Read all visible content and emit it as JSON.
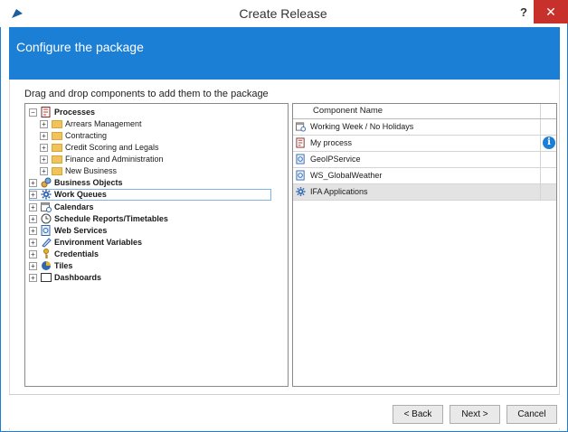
{
  "window": {
    "title": "Create Release",
    "help_label": "?",
    "close_label": "✕",
    "accent_color": "#1c7fd6",
    "close_color": "#c7302b"
  },
  "banner": {
    "title": "Configure the package"
  },
  "instruction": "Drag and drop components to add them to the package",
  "tree": {
    "items": [
      {
        "label": "Processes",
        "expander": "−",
        "icon": "process-icon",
        "bold": true
      },
      {
        "label": "Arrears Management",
        "expander": "+",
        "icon": "folder-icon",
        "bold": false
      },
      {
        "label": "Contracting",
        "expander": "+",
        "icon": "folder-icon",
        "bold": false
      },
      {
        "label": "Credit Scoring and Legals",
        "expander": "+",
        "icon": "folder-icon",
        "bold": false
      },
      {
        "label": "Finance and Administration",
        "expander": "+",
        "icon": "folder-icon",
        "bold": false
      },
      {
        "label": "New Business",
        "expander": "+",
        "icon": "folder-icon",
        "bold": false
      },
      {
        "label": "Business Objects",
        "expander": "+",
        "icon": "business-objects-icon",
        "bold": true
      },
      {
        "label": "Work Queues",
        "expander": "+",
        "icon": "gear-icon",
        "bold": true
      },
      {
        "label": "Calendars",
        "expander": "+",
        "icon": "calendar-icon",
        "bold": true
      },
      {
        "label": "Schedule Reports/Timetables",
        "expander": "+",
        "icon": "clock-icon",
        "bold": true
      },
      {
        "label": "Web Services",
        "expander": "+",
        "icon": "web-service-icon",
        "bold": true
      },
      {
        "label": "Environment Variables",
        "expander": "+",
        "icon": "variable-icon",
        "bold": true
      },
      {
        "label": "Credentials",
        "expander": "+",
        "icon": "key-icon",
        "bold": true
      },
      {
        "label": "Tiles",
        "expander": "+",
        "icon": "tiles-icon",
        "bold": true
      },
      {
        "label": "Dashboards",
        "expander": "+",
        "icon": "dashboard-icon",
        "bold": true
      }
    ]
  },
  "component_list": {
    "header": "Component Name",
    "rows": [
      {
        "label": "Working Week / No Holidays",
        "icon": "calendar-icon"
      },
      {
        "label": "My process",
        "icon": "process-icon",
        "info": "i"
      },
      {
        "label": "GeoIPService",
        "icon": "web-service-icon"
      },
      {
        "label": "WS_GlobalWeather",
        "icon": "web-service-icon"
      },
      {
        "label": "IFA Applications",
        "icon": "gear-icon"
      }
    ]
  },
  "buttons": {
    "back": "< Back",
    "next": "Next >",
    "cancel": "Cancel"
  }
}
